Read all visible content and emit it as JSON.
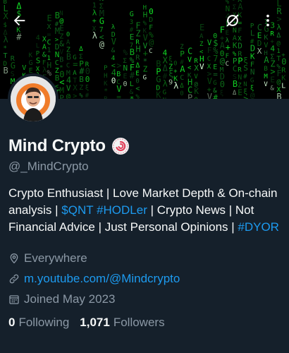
{
  "header": {
    "back_icon": "arrow-left-icon",
    "grok_icon": "grok-icon",
    "more_icon": "more-vertical-icon"
  },
  "profile": {
    "name": "Mind Crypto",
    "badge_icon": "sticker-badge",
    "handle": "@_MindCrypto",
    "bio": {
      "part1": "Crypto Enthusiast | Love Market Depth & On-chain analysis | ",
      "tag_qnt": "$QNT",
      "space": " ",
      "tag_hodl": "#HODLer",
      "part2": " | Crypto News | Not Financial Advice | Just Personal Opinions | ",
      "tag_dyor": "#DYOR"
    },
    "location": "Everywhere",
    "link": "m.youtube.com/@Mindcrypto",
    "joined": "Joined May 2023",
    "following_count": "0",
    "following_label": "Following",
    "followers_count": "1,071",
    "followers_label": "Followers"
  },
  "colors": {
    "background": "#15202b",
    "accent": "#1d9bf0",
    "secondary_text": "#8b98a5"
  }
}
